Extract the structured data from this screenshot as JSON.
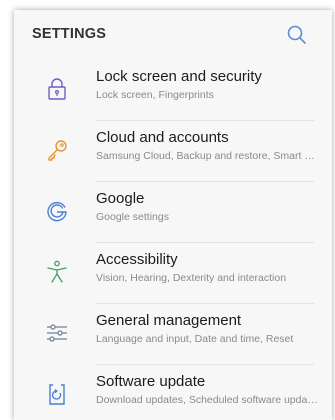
{
  "header": {
    "title": "SETTINGS",
    "search_icon": "search-icon"
  },
  "colors": {
    "lock": "#6f5fc4",
    "cloud": "#f0922e",
    "google": "#4c7fd6",
    "accessibility": "#3fa362",
    "general": "#6f7f99",
    "software": "#4c7fd6",
    "search": "#5a8cd8"
  },
  "items": [
    {
      "title": "Lock screen and security",
      "subtitle": "Lock screen, Fingerprints",
      "icon": "lock-icon"
    },
    {
      "title": "Cloud and accounts",
      "subtitle": "Samsung Cloud, Backup and restore, Smart Switch",
      "icon": "key-icon"
    },
    {
      "title": "Google",
      "subtitle": "Google settings",
      "icon": "google-icon"
    },
    {
      "title": "Accessibility",
      "subtitle": "Vision, Hearing, Dexterity and interaction",
      "icon": "accessibility-icon"
    },
    {
      "title": "General management",
      "subtitle": "Language and input, Date and time, Reset",
      "icon": "sliders-icon"
    },
    {
      "title": "Software update",
      "subtitle": "Download updates, Scheduled software updates",
      "icon": "software-update-icon"
    }
  ]
}
